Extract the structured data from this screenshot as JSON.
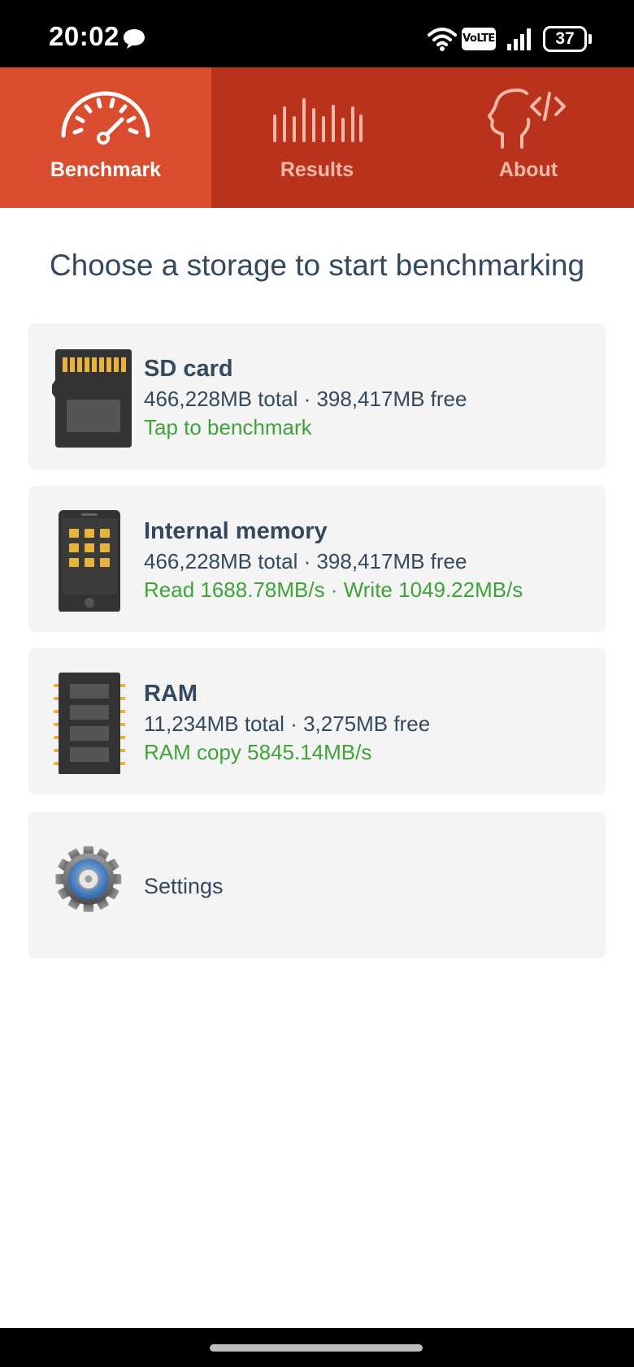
{
  "status_bar": {
    "time": "20:02",
    "volte": "VoLTE",
    "battery": "37"
  },
  "tabs": [
    {
      "label": "Benchmark",
      "icon": "speedometer-icon",
      "active": true
    },
    {
      "label": "Results",
      "icon": "bar-chart-icon",
      "active": false
    },
    {
      "label": "About",
      "icon": "head-code-icon",
      "active": false
    }
  ],
  "heading": "Choose a storage to start benchmarking",
  "storages": [
    {
      "title": "SD card",
      "info": "466,228MB total · 398,417MB free",
      "status": "Tap to benchmark",
      "icon": "sd-card-icon"
    },
    {
      "title": "Internal memory",
      "info": "466,228MB total · 398,417MB free",
      "status": "Read 1688.78MB/s · Write 1049.22MB/s",
      "icon": "phone-icon"
    },
    {
      "title": "RAM",
      "info": "11,234MB total · 3,275MB free",
      "status": "RAM copy 5845.14MB/s",
      "icon": "ram-chip-icon"
    }
  ],
  "settings": {
    "label": "Settings",
    "icon": "gear-icon"
  },
  "colors": {
    "tab_bar": "#b9321c",
    "tab_active": "#d94c2e",
    "status_green": "#3fa33a",
    "text": "#34495e",
    "card_bg": "#f4f4f4"
  }
}
